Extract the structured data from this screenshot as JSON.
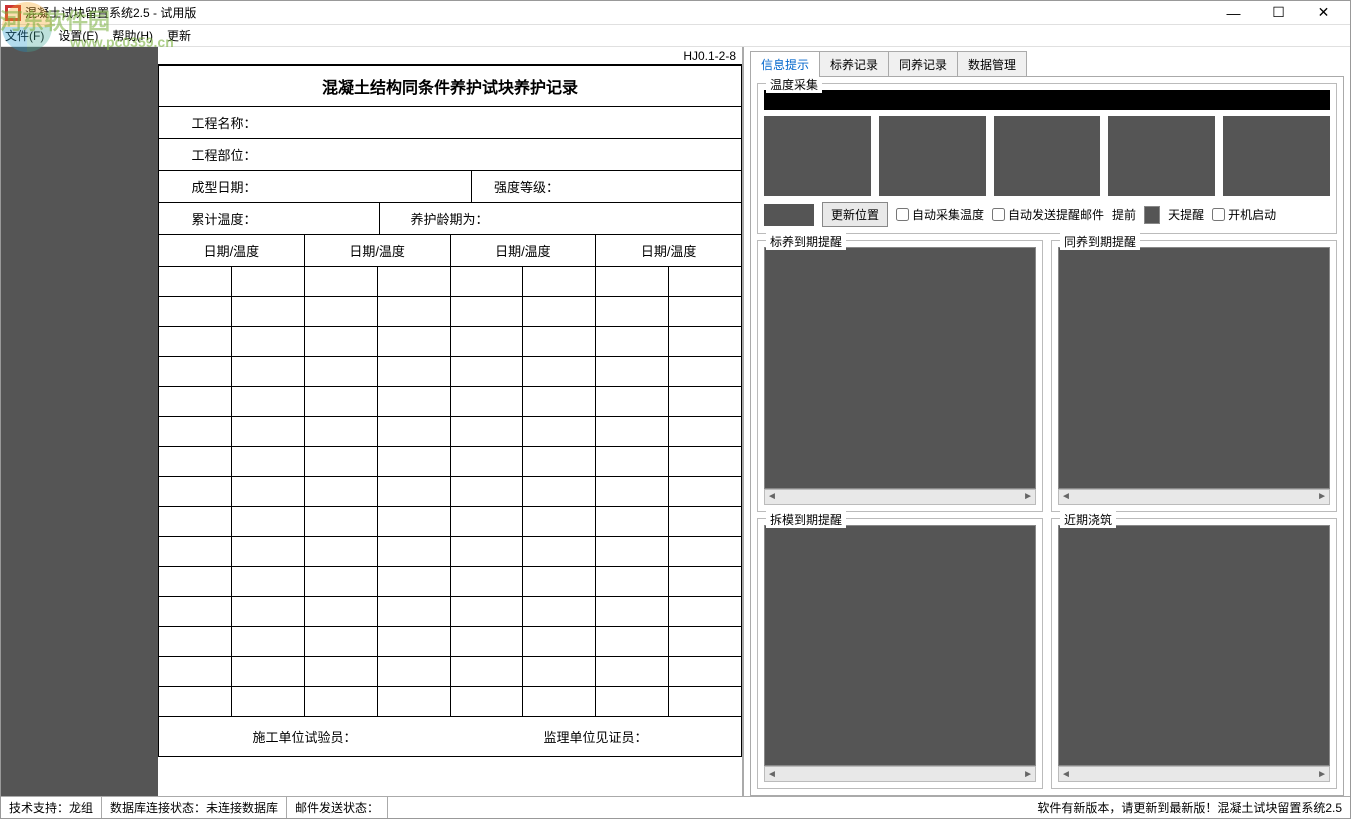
{
  "window": {
    "title": "混凝土试块留置系统2.5 - 试用版",
    "minimize": "—",
    "maximize": "☐",
    "close": "✕"
  },
  "menu": {
    "file": "文件(F)",
    "settings": "设置(E)",
    "help": "帮助(H)",
    "update": "更新"
  },
  "watermark": {
    "main": "河东软件园",
    "sub": "www.pc0359.cn"
  },
  "doc": {
    "code": "HJ0.1-2-8",
    "title": "混凝土结构同条件养护试块养护记录",
    "labels": {
      "project_name": "工程名称：",
      "project_part": "工程部位：",
      "form_date": "成型日期：",
      "strength": "强度等级：",
      "acc_temp": "累计温度：",
      "cure_period": "养护龄期为：",
      "col_header": "日期/温度",
      "inspector": "施工单位试验员：",
      "witness": "监理单位见证员："
    }
  },
  "tabs": {
    "t1": "信息提示",
    "t2": "标养记录",
    "t3": "同养记录",
    "t4": "数据管理"
  },
  "groups": {
    "temp_collect": "温度采集",
    "update_pos": "更新位置",
    "auto_collect": "自动采集温度",
    "auto_mail": "自动发送提醒邮件",
    "before": "提前",
    "days_remind": "天提醒",
    "boot_start": "开机启动",
    "by_remind": "标养到期提醒",
    "ty_remind": "同养到期提醒",
    "cm_remind": "拆模到期提醒",
    "recent": "近期浇筑"
  },
  "status": {
    "tech": "技术支持：龙组",
    "db": "数据库连接状态：未连接数据库",
    "mail": "邮件发送状态：",
    "update_msg": "软件有新版本，请更新到最新版！混凝土试块留置系统2.5"
  }
}
